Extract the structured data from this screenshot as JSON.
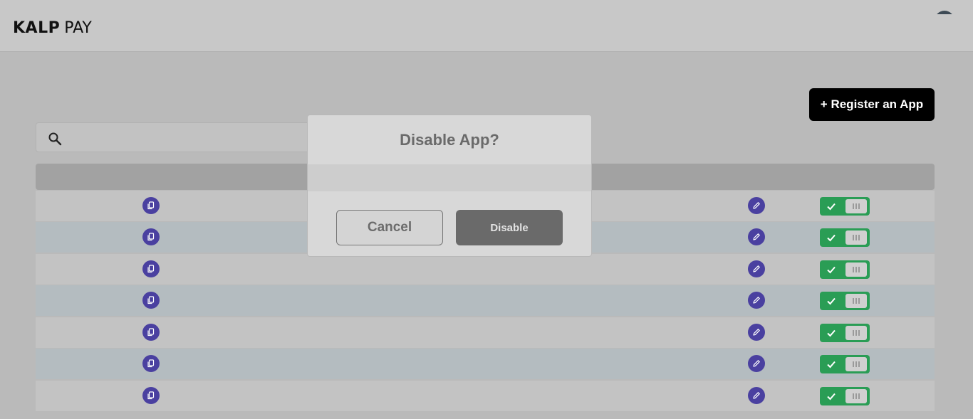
{
  "header": {
    "logo_brand": "KALP",
    "logo_suffix": "PAY"
  },
  "actions": {
    "register_label": "+ Register an App"
  },
  "search": {
    "placeholder": "",
    "value": ""
  },
  "rows": [
    {
      "enabled": true
    },
    {
      "enabled": true
    },
    {
      "enabled": true
    },
    {
      "enabled": true
    },
    {
      "enabled": true
    },
    {
      "enabled": true
    },
    {
      "enabled": true
    }
  ],
  "modal": {
    "title": "Disable App?",
    "cancel_label": "Cancel",
    "confirm_label": "Disable"
  },
  "colors": {
    "accent_purple": "#4a40a0",
    "toggle_green": "#2a9d55",
    "primary_black": "#000000"
  },
  "icons": {
    "search": "search-icon",
    "copy": "copy-icon",
    "edit": "pencil-icon",
    "toggle_check": "check-icon"
  }
}
